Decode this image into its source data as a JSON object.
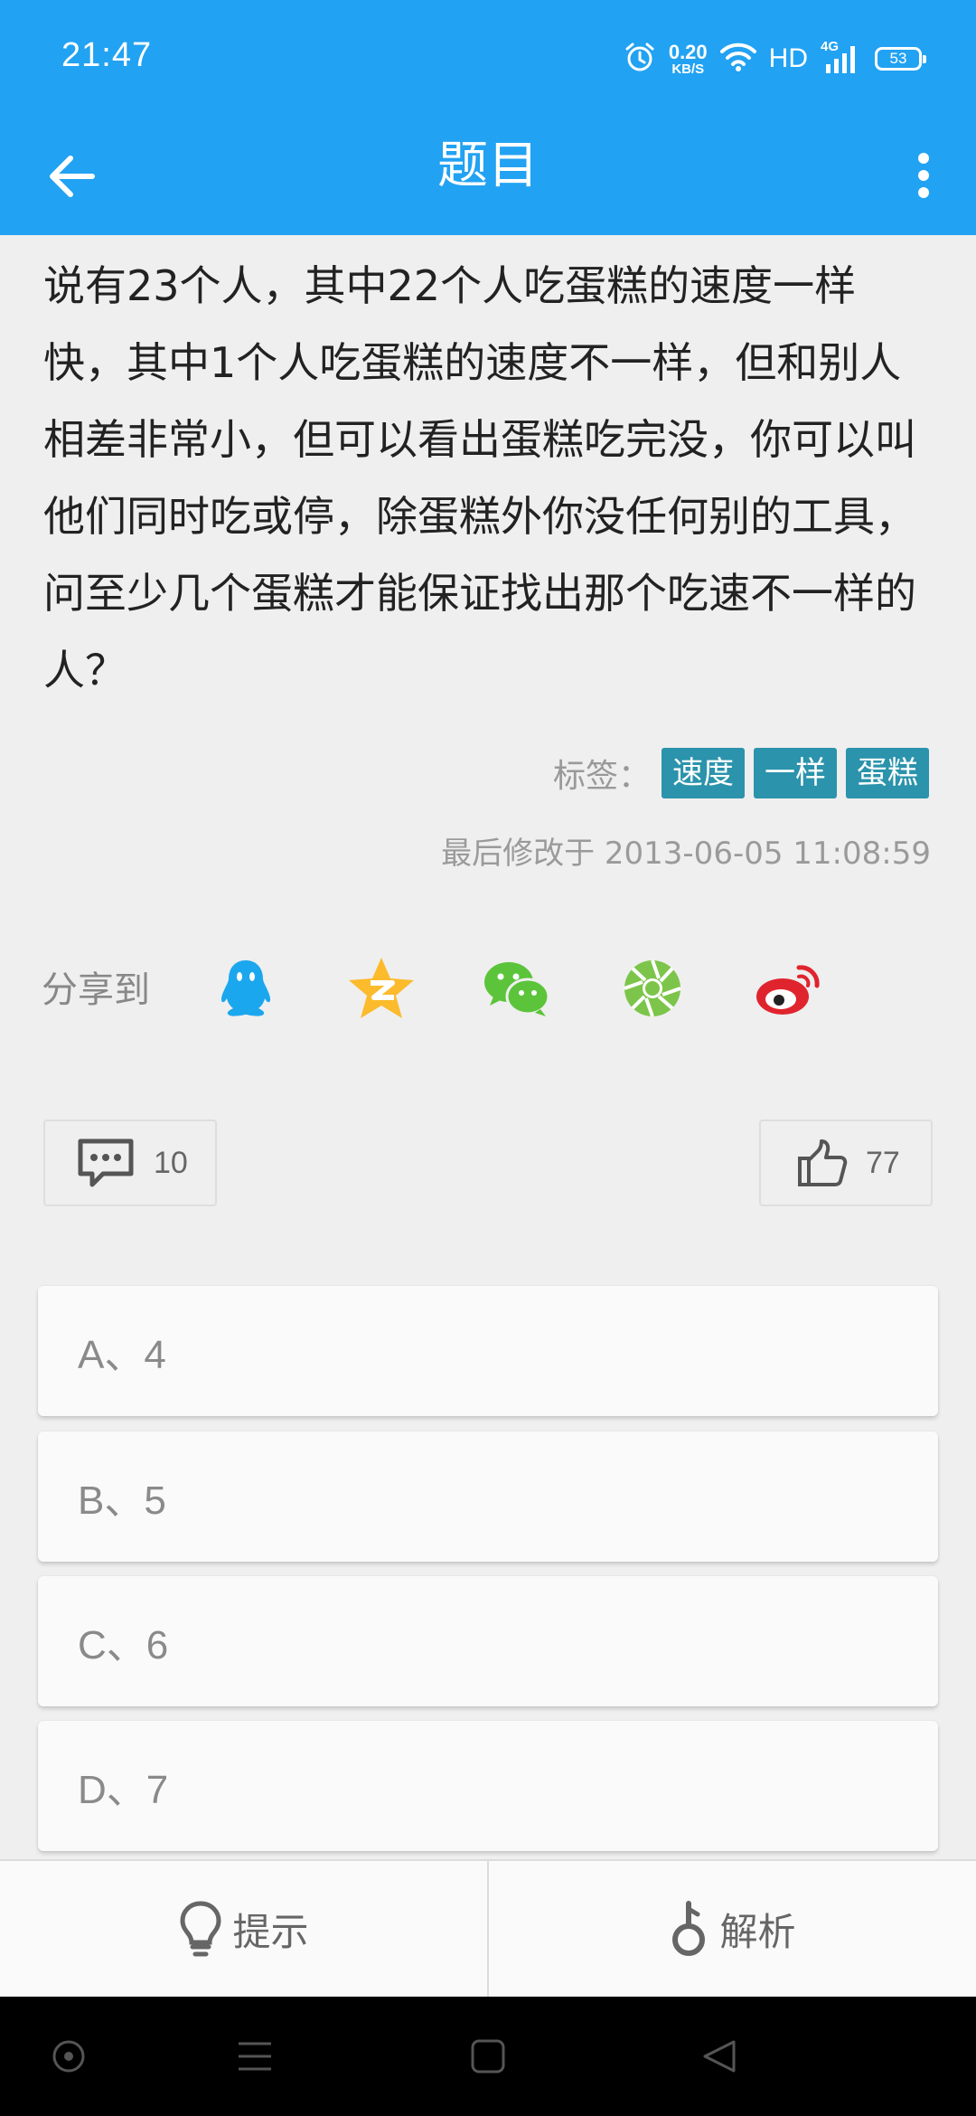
{
  "status_bar": {
    "time": "21:47",
    "speed_value": "0.20",
    "speed_unit": "KB/S",
    "hd": "HD",
    "network": "4G",
    "battery": "53",
    "icons": [
      "alarm-icon",
      "wifi-icon",
      "signal-icon",
      "battery-icon"
    ]
  },
  "app_bar": {
    "title": "题目",
    "back_icon": "arrow-left-icon",
    "more_icon": "more-vertical-icon",
    "background": "#22a2f2"
  },
  "question": {
    "text": "说有23个人，其中22个人吃蛋糕的速度一样快，其中1个人吃蛋糕的速度不一样，但和别人相差非常小，但可以看出蛋糕吃完没，你可以叫他们同时吃或停，除蛋糕外你没任何别的工具，问至少几个蛋糕才能保证找出那个吃速不一样的人？"
  },
  "tags": {
    "label": "标签：",
    "items": [
      "速度",
      "一样",
      "蛋糕"
    ],
    "color": "#2b93ab"
  },
  "modified": "最后修改于 2013-06-05 11:08:59",
  "share": {
    "label": "分享到",
    "targets": [
      "qq-icon",
      "qzone-icon",
      "wechat-icon",
      "moments-icon",
      "weibo-icon"
    ]
  },
  "counters": {
    "comments": "10",
    "likes": "77"
  },
  "options": [
    {
      "label": "A、4"
    },
    {
      "label": "B、5"
    },
    {
      "label": "C、6"
    },
    {
      "label": "D、7"
    }
  ],
  "actions": {
    "hint": "提示",
    "analysis": "解析"
  },
  "nav": [
    "assistant-icon",
    "menu-icon",
    "home-icon",
    "back-icon"
  ]
}
